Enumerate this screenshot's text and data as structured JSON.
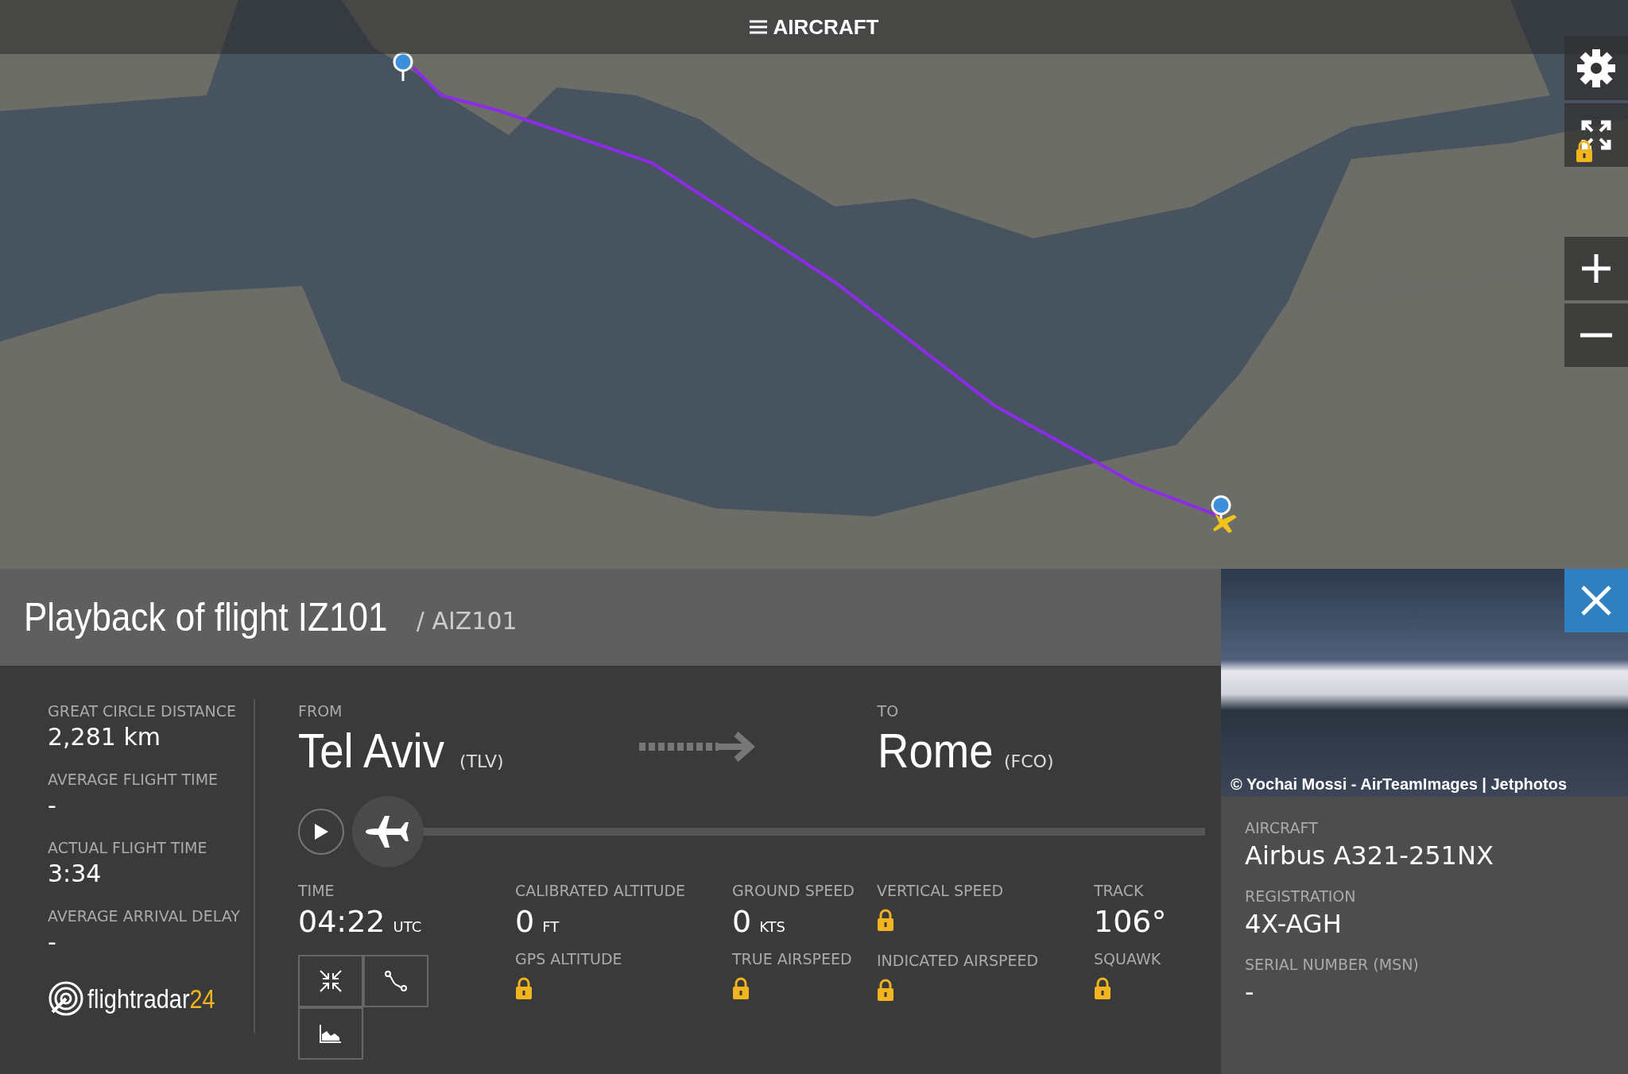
{
  "top_bar": {
    "label": "AIRCRAFT"
  },
  "map_controls": [
    {
      "kind": "settings",
      "locked": false
    },
    {
      "kind": "fullscreen",
      "locked": true
    },
    {
      "kind": "zoom-in",
      "locked": false
    },
    {
      "kind": "zoom-out",
      "locked": false
    }
  ],
  "title": {
    "text": "Playback of flight IZ101",
    "code": "/ AIZ101"
  },
  "summary": [
    {
      "label": "GREAT CIRCLE DISTANCE",
      "value": "2,281 km"
    },
    {
      "label": "AVERAGE FLIGHT TIME",
      "value": "-"
    },
    {
      "label": "ACTUAL FLIGHT TIME",
      "value": "3:34"
    },
    {
      "label": "AVERAGE ARRIVAL DELAY",
      "value": "-"
    }
  ],
  "logo": {
    "text": "flightradar",
    "accent": "24"
  },
  "route": {
    "from": {
      "label": "FROM",
      "city": "Tel Aviv",
      "code": "(TLV)"
    },
    "to": {
      "label": "TO",
      "city": "Rome",
      "code": "(FCO)"
    }
  },
  "playback": {
    "level": 0
  },
  "stats": [
    {
      "items": [
        {
          "label": "TIME",
          "value": "04:22",
          "unit": "UTC",
          "locked": false
        }
      ],
      "tools": true
    },
    {
      "items": [
        {
          "label": "CALIBRATED ALTITUDE",
          "value": "0",
          "unit": "FT",
          "locked": false
        },
        {
          "label": "GPS ALTITUDE",
          "locked": true
        }
      ],
      "tools": false
    },
    {
      "items": [
        {
          "label": "GROUND SPEED",
          "value": "0",
          "unit": "KTS",
          "locked": false
        },
        {
          "label": "TRUE AIRSPEED",
          "locked": true
        }
      ],
      "tools": false
    },
    {
      "items": [
        {
          "label": "VERTICAL SPEED",
          "locked": true
        },
        {
          "label": "INDICATED AIRSPEED",
          "locked": true
        }
      ],
      "tools": false
    },
    {
      "items": [
        {
          "label": "TRACK",
          "value": "106°",
          "locked": false
        },
        {
          "label": "SQUAWK",
          "locked": true
        }
      ],
      "tools": false
    }
  ],
  "aircraft": {
    "photo_credit": "© Yochai Mossi - AirTeamImages | Jetphotos",
    "fields": [
      {
        "label": "AIRCRAFT",
        "value": "Airbus A321-251NX"
      },
      {
        "label": "REGISTRATION",
        "value": "4X-AGH"
      },
      {
        "label": "SERIAL NUMBER (MSN)",
        "value": "-"
      }
    ]
  }
}
